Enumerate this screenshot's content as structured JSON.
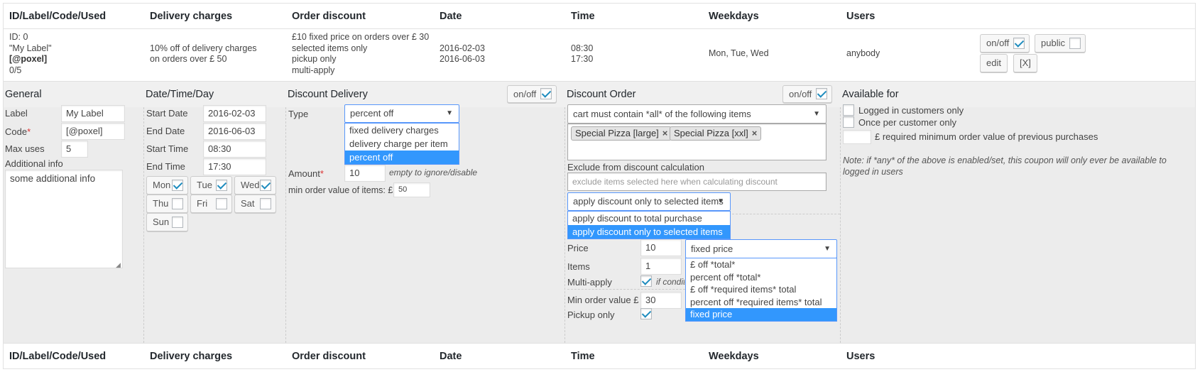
{
  "columns": [
    "ID/Label/Code/Used",
    "Delivery charges",
    "Order discount",
    "Date",
    "Time",
    "Weekdays",
    "Users"
  ],
  "coupon": {
    "id": "ID: 0",
    "label": "\"My Label\"",
    "code": "[@poxel]",
    "used": "0/5",
    "delivery_lines": [
      "10% off of delivery charges",
      "on orders over £ 50"
    ],
    "order_lines": [
      "£10 fixed price on orders over £ 30",
      "selected items only",
      "pickup only",
      "multi-apply"
    ],
    "dates": [
      "2016-02-03",
      "2016-06-03"
    ],
    "times": [
      "08:30",
      "17:30"
    ],
    "weekdays": "Mon, Tue, Wed",
    "users": "anybody",
    "buttons": {
      "onoff": "on/off",
      "public": "public",
      "edit": "edit",
      "delete": "[X]"
    }
  },
  "general": {
    "title": "General",
    "label_lbl": "Label",
    "label_val": "My Label",
    "code_lbl": "Code",
    "code_req": "*",
    "code_val": "[@poxel]",
    "maxuses_lbl": "Max uses",
    "maxuses_val": "5",
    "info_lbl": "Additional info",
    "info_val": "some additional info"
  },
  "datetime": {
    "title": "Date/Time/Day",
    "start_date_lbl": "Start Date",
    "start_date": "2016-02-03",
    "end_date_lbl": "End Date",
    "end_date": "2016-06-03",
    "start_time_lbl": "Start Time",
    "start_time": "08:30",
    "end_time_lbl": "End Time",
    "end_time": "17:30",
    "days": [
      {
        "name": "Mon",
        "checked": true
      },
      {
        "name": "Tue",
        "checked": true
      },
      {
        "name": "Wed",
        "checked": true
      },
      {
        "name": "Thu",
        "checked": false
      },
      {
        "name": "Fri",
        "checked": false
      },
      {
        "name": "Sat",
        "checked": false
      },
      {
        "name": "Sun",
        "checked": false
      }
    ]
  },
  "discount_delivery": {
    "title": "Discount Delivery",
    "onoff": "on/off",
    "type_lbl": "Type",
    "type_selected": "percent off",
    "type_options": [
      "fixed delivery charges",
      "delivery charge per item",
      "percent off"
    ],
    "amount_lbl": "Amount",
    "amount_req": "*",
    "amount_val": "10",
    "amount_hint": "empty to ignore/disable",
    "minorder_lbl": "min order value of items: £",
    "minorder_val": "50"
  },
  "discount_order": {
    "title": "Discount Order",
    "onoff": "on/off",
    "condition_selected": "cart must contain *all* of the following items",
    "items": [
      "Special Pizza [large]",
      "Special Pizza [xxl]"
    ],
    "exclude_lbl": "Exclude from discount calculation",
    "exclude_ph": "exclude items selected here when calculating discount",
    "apply_selected": "apply discount only to selected items",
    "apply_options": [
      "apply discount to total purchase",
      "apply discount only to selected items"
    ],
    "price_lbl": "Price",
    "price_val": "10",
    "price_type_selected": "fixed price",
    "price_type_options": [
      "£ off *total*",
      "percent off *total*",
      "£ off *required items* total",
      "percent off *required items* total",
      "fixed price"
    ],
    "items_lbl": "Items",
    "items_val": "1",
    "multiapply_lbl": "Multi-apply",
    "multiapply_hint": "if condit",
    "minorder_lbl": "Min order value £",
    "minorder_val": "30",
    "pickup_lbl": "Pickup only"
  },
  "available": {
    "title": "Available for",
    "logged_in": "Logged in customers only",
    "once": "Once per customer only",
    "min_prev": "£ required minimum order value of previous purchases",
    "note": "Note: if *any* of the above is enabled/set, this coupon will only ever be available to logged in users"
  }
}
